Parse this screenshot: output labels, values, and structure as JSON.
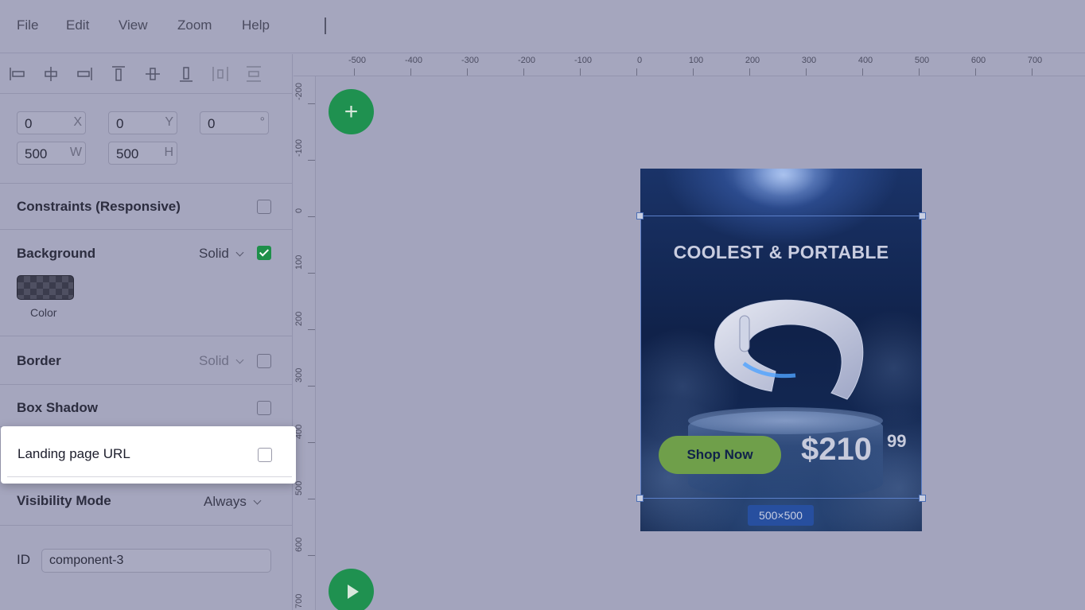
{
  "menu": [
    "File",
    "Edit",
    "View",
    "Zoom",
    "Help"
  ],
  "toolbar_icons": [
    "align-left-icon",
    "align-center-horizontal-icon",
    "align-right-icon",
    "align-top-icon",
    "align-center-vertical-icon",
    "align-bottom-icon",
    "distribute-horizontal-icon",
    "distribute-vertical-icon"
  ],
  "geometry": {
    "x": {
      "value": "0",
      "suffix": "X"
    },
    "y": {
      "value": "0",
      "suffix": "Y"
    },
    "rotation": {
      "value": "0",
      "suffix": "°"
    },
    "w": {
      "value": "500",
      "suffix": "W"
    },
    "h": {
      "value": "500",
      "suffix": "H"
    }
  },
  "sections": {
    "constraints": {
      "title": "Constraints (Responsive)",
      "checked": false
    },
    "background": {
      "title": "Background",
      "mode": "Solid",
      "checked": true,
      "swatch_label": "Color"
    },
    "border": {
      "title": "Border",
      "mode": "Solid",
      "checked": false
    },
    "box_shadow": {
      "title": "Box Shadow",
      "checked": false
    },
    "landing_url": {
      "title": "Landing page URL",
      "checked": false
    },
    "visibility": {
      "title": "Visibility Mode",
      "mode": "Always"
    },
    "id": {
      "label": "ID",
      "value": "component-3"
    }
  },
  "ruler": {
    "h_labels": [
      "-500",
      "-400",
      "-300",
      "-200",
      "-100",
      "0",
      "100",
      "200",
      "300",
      "400",
      "500",
      "600",
      "700"
    ],
    "v_labels": [
      "-200",
      "-100",
      "0",
      "100",
      "200",
      "300",
      "400",
      "500",
      "600",
      "700"
    ]
  },
  "ad": {
    "headline": "COOLEST & PORTABLE",
    "cta": "Shop Now",
    "price": "$210",
    "cents": "99",
    "size_badge": "500×500"
  },
  "colors": {
    "accent_green": "#1f9150",
    "selection_blue": "#5b7fc9",
    "cta_green": "#6f9f4a"
  }
}
